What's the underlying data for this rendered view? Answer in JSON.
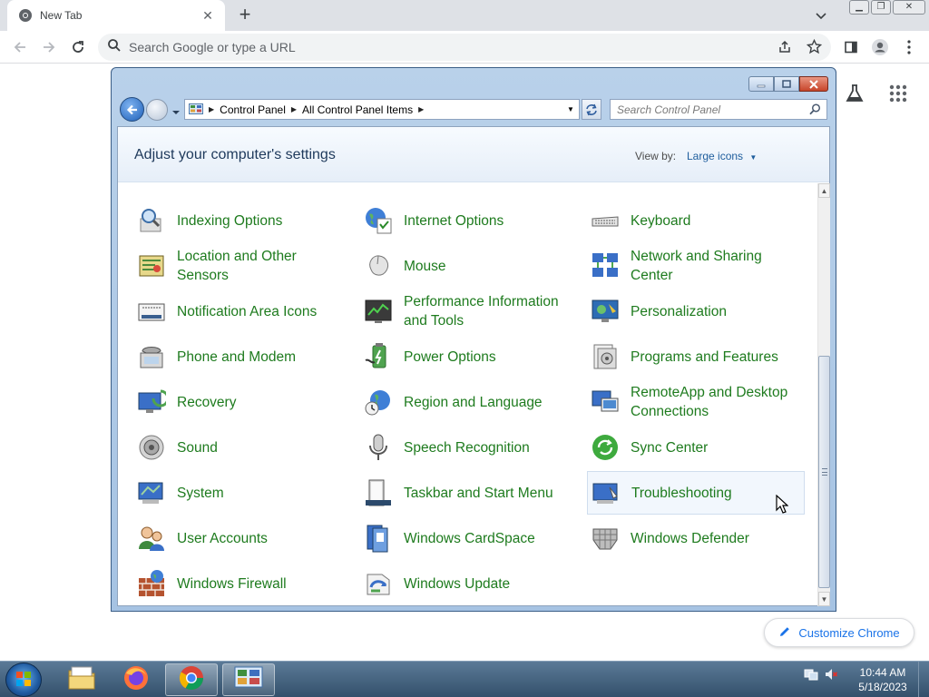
{
  "browser": {
    "tab_title": "New Tab",
    "tab_close_glyph": "✕",
    "new_tab_glyph": "+",
    "omnibox_placeholder": "Search Google or type a URL"
  },
  "ntp": {
    "customize_label": "Customize Chrome"
  },
  "window": {
    "breadcrumbs": [
      "Control Panel",
      "All Control Panel Items"
    ],
    "search_placeholder": "Search Control Panel",
    "heading": "Adjust your computer's settings",
    "view_by_label": "View by:",
    "view_by_value": "Large icons"
  },
  "items": [
    {
      "label": "Indexing Options",
      "icon": "indexing-icon"
    },
    {
      "label": "Internet Options",
      "icon": "internet-options-icon"
    },
    {
      "label": "Keyboard",
      "icon": "keyboard-icon"
    },
    {
      "label": "Location and Other Sensors",
      "icon": "location-sensors-icon"
    },
    {
      "label": "Mouse",
      "icon": "mouse-icon"
    },
    {
      "label": "Network and Sharing Center",
      "icon": "network-icon"
    },
    {
      "label": "Notification Area Icons",
      "icon": "notification-area-icon"
    },
    {
      "label": "Performance Information and Tools",
      "icon": "performance-icon"
    },
    {
      "label": "Personalization",
      "icon": "personalization-icon"
    },
    {
      "label": "Phone and Modem",
      "icon": "phone-modem-icon"
    },
    {
      "label": "Power Options",
      "icon": "power-options-icon"
    },
    {
      "label": "Programs and Features",
      "icon": "programs-features-icon"
    },
    {
      "label": "Recovery",
      "icon": "recovery-icon"
    },
    {
      "label": "Region and Language",
      "icon": "region-language-icon"
    },
    {
      "label": "RemoteApp and Desktop Connections",
      "icon": "remoteapp-icon"
    },
    {
      "label": "Sound",
      "icon": "sound-icon"
    },
    {
      "label": "Speech Recognition",
      "icon": "speech-recognition-icon"
    },
    {
      "label": "Sync Center",
      "icon": "sync-center-icon"
    },
    {
      "label": "System",
      "icon": "system-icon"
    },
    {
      "label": "Taskbar and Start Menu",
      "icon": "taskbar-start-menu-icon"
    },
    {
      "label": "Troubleshooting",
      "icon": "troubleshooting-icon"
    },
    {
      "label": "User Accounts",
      "icon": "user-accounts-icon"
    },
    {
      "label": "Windows CardSpace",
      "icon": "cardspace-icon"
    },
    {
      "label": "Windows Defender",
      "icon": "defender-icon"
    },
    {
      "label": "Windows Firewall",
      "icon": "firewall-icon"
    },
    {
      "label": "Windows Update",
      "icon": "windows-update-icon"
    }
  ],
  "taskbar": {
    "time": "10:44 AM",
    "date": "5/18/2023"
  },
  "colors": {
    "item_link": "#1e7b1e",
    "heading": "#1e395b",
    "chrome_accent": "#1a73e8"
  }
}
